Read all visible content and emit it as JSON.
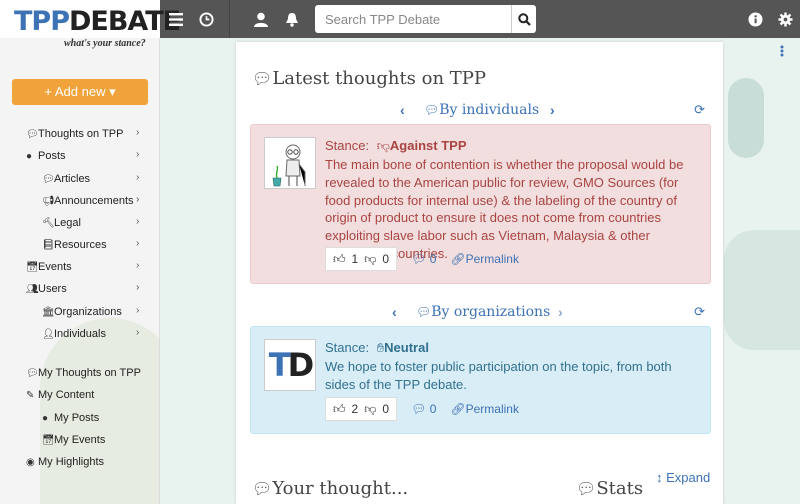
{
  "header": {
    "logo_part1": "TPP",
    "logo_part2": "DEBATE",
    "tagline": "what's your stance?",
    "search_placeholder": "Search TPP Debate"
  },
  "sidebar": {
    "add_new": "+ Add new ▾",
    "items": [
      {
        "label": "Thoughts on TPP",
        "icon": "comment-icon"
      },
      {
        "label": "Posts",
        "icon": "circle-icon"
      },
      {
        "label": "Articles",
        "icon": "comment-icon"
      },
      {
        "label": "Announcements",
        "icon": "megaphone-icon"
      },
      {
        "label": "Legal",
        "icon": "gavel-icon"
      },
      {
        "label": "Resources",
        "icon": "book-icon"
      },
      {
        "label": "Events",
        "icon": "calendar-icon"
      },
      {
        "label": "Users",
        "icon": "users-icon"
      },
      {
        "label": "Organizations",
        "icon": "bank-icon"
      },
      {
        "label": "Individuals",
        "icon": "user-icon"
      },
      {
        "label": "My Thoughts on TPP",
        "icon": "comment-icon"
      },
      {
        "label": "My Content",
        "icon": "edit-icon"
      },
      {
        "label": "My Posts",
        "icon": "circle-icon"
      },
      {
        "label": "My Events",
        "icon": "calendar-icon"
      },
      {
        "label": "My Highlights",
        "icon": "dot-circle-icon"
      }
    ]
  },
  "main": {
    "title": "Latest thoughts on TPP",
    "individuals": {
      "heading": "By individuals",
      "stance_label": "Stance:",
      "stance": "Against TPP",
      "text": "The main bone of contention is whether the proposal would be revealed to the American public for review, GMO Sources (for food products for internal use) & the labeling of the country of origin of product to ensure it does not come from countries exploiting slave labor such as Vietnam, Malaysia & other developing countries.",
      "upvotes": "1",
      "downvotes": "0",
      "comments": "0",
      "permalink": "Permalink"
    },
    "organizations": {
      "heading": "By organizations",
      "stance_label": "Stance:",
      "stance": "Neutral",
      "text": "We hope to foster public participation on the topic, from both sides of the TPP debate.",
      "upvotes": "2",
      "downvotes": "0",
      "comments": "0",
      "permalink": "Permalink",
      "avatar_text": "TD"
    },
    "your_thought": "Your thought...",
    "stats": "Stats",
    "expand": "Expand"
  },
  "colors": {
    "topbar": "#555555",
    "accent": "#3d72b5",
    "add_new": "#f0a33a",
    "against_bg": "#f2dede",
    "neutral_bg": "#d9edf7"
  }
}
